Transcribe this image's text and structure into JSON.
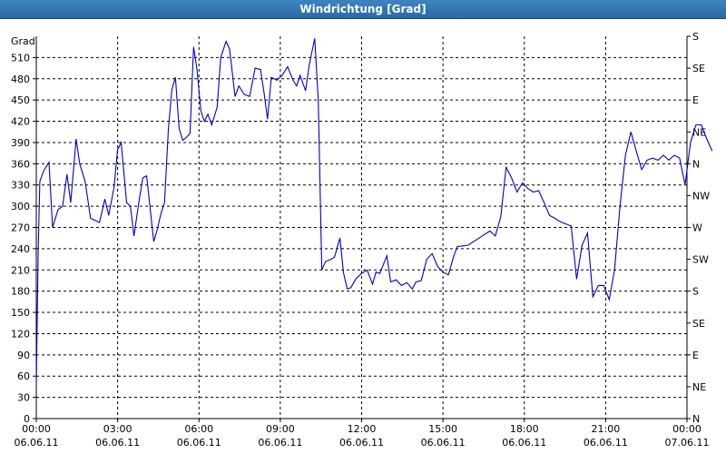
{
  "window": {
    "title": "Windrichtung [Grad]"
  },
  "chart_data": {
    "type": "line",
    "title": "Windrichtung [Grad]",
    "ylabel": "Grad",
    "ylim": [
      0,
      540
    ],
    "y_ticks": [
      0,
      30,
      60,
      90,
      120,
      150,
      180,
      210,
      240,
      270,
      300,
      330,
      360,
      390,
      420,
      450,
      480,
      510
    ],
    "right_axis_labels": [
      "N",
      "NE",
      "E",
      "SE",
      "S",
      "SW",
      "W",
      "NW",
      "N",
      "NE",
      "E",
      "SE",
      "S"
    ],
    "right_axis_values": [
      0,
      45,
      90,
      135,
      180,
      225,
      270,
      315,
      360,
      405,
      450,
      495,
      540
    ],
    "x_range_hours": [
      0,
      24
    ],
    "x_ticks": [
      {
        "h": 0,
        "time": "00:00",
        "date": "06.06.11"
      },
      {
        "h": 3,
        "time": "03:00",
        "date": "06.06.11"
      },
      {
        "h": 6,
        "time": "06:00",
        "date": "06.06.11"
      },
      {
        "h": 9,
        "time": "09:00",
        "date": "06.06.11"
      },
      {
        "h": 12,
        "time": "12:00",
        "date": "06.06.11"
      },
      {
        "h": 15,
        "time": "15:00",
        "date": "06.06.11"
      },
      {
        "h": 18,
        "time": "18:00",
        "date": "06.06.11"
      },
      {
        "h": 21,
        "time": "21:00",
        "date": "06.06.11"
      },
      {
        "h": 24,
        "time": "00:00",
        "date": "07.06.11"
      }
    ],
    "grid": true,
    "line_color": "#0000cc",
    "series": [
      {
        "points": [
          [
            0.0,
            50
          ],
          [
            0.07,
            240
          ],
          [
            0.13,
            335
          ],
          [
            0.27,
            350
          ],
          [
            0.47,
            362
          ],
          [
            0.6,
            270
          ],
          [
            0.8,
            295
          ],
          [
            0.97,
            300
          ],
          [
            1.13,
            345
          ],
          [
            1.27,
            305
          ],
          [
            1.47,
            395
          ],
          [
            1.6,
            360
          ],
          [
            1.8,
            335
          ],
          [
            2.0,
            283
          ],
          [
            2.33,
            277
          ],
          [
            2.53,
            310
          ],
          [
            2.67,
            287
          ],
          [
            2.87,
            327
          ],
          [
            3.0,
            380
          ],
          [
            3.13,
            390
          ],
          [
            3.33,
            305
          ],
          [
            3.47,
            300
          ],
          [
            3.6,
            258
          ],
          [
            3.8,
            310
          ],
          [
            3.93,
            340
          ],
          [
            4.07,
            343
          ],
          [
            4.33,
            250
          ],
          [
            4.47,
            268
          ],
          [
            4.6,
            290
          ],
          [
            4.73,
            305
          ],
          [
            4.87,
            408
          ],
          [
            5.0,
            465
          ],
          [
            5.13,
            482
          ],
          [
            5.27,
            410
          ],
          [
            5.4,
            393
          ],
          [
            5.53,
            397
          ],
          [
            5.67,
            403
          ],
          [
            5.8,
            525
          ],
          [
            5.93,
            492
          ],
          [
            6.07,
            435
          ],
          [
            6.2,
            420
          ],
          [
            6.33,
            430
          ],
          [
            6.47,
            415
          ],
          [
            6.67,
            440
          ],
          [
            6.8,
            510
          ],
          [
            7.0,
            533
          ],
          [
            7.13,
            522
          ],
          [
            7.33,
            455
          ],
          [
            7.47,
            470
          ],
          [
            7.67,
            458
          ],
          [
            7.87,
            455
          ],
          [
            8.07,
            495
          ],
          [
            8.27,
            493
          ],
          [
            8.4,
            460
          ],
          [
            8.53,
            423
          ],
          [
            8.67,
            482
          ],
          [
            8.87,
            478
          ],
          [
            9.07,
            485
          ],
          [
            9.27,
            497
          ],
          [
            9.47,
            478
          ],
          [
            9.6,
            470
          ],
          [
            9.73,
            485
          ],
          [
            9.93,
            463
          ],
          [
            10.07,
            500
          ],
          [
            10.27,
            537
          ],
          [
            10.4,
            450
          ],
          [
            10.53,
            210
          ],
          [
            10.67,
            222
          ],
          [
            10.87,
            225
          ],
          [
            11.0,
            228
          ],
          [
            11.2,
            255
          ],
          [
            11.33,
            206
          ],
          [
            11.47,
            183
          ],
          [
            11.6,
            185
          ],
          [
            11.8,
            198
          ],
          [
            12.0,
            205
          ],
          [
            12.2,
            210
          ],
          [
            12.4,
            190
          ],
          [
            12.53,
            207
          ],
          [
            12.67,
            205
          ],
          [
            12.93,
            230
          ],
          [
            13.07,
            193
          ],
          [
            13.27,
            196
          ],
          [
            13.47,
            188
          ],
          [
            13.67,
            192
          ],
          [
            13.87,
            183
          ],
          [
            14.0,
            193
          ],
          [
            14.2,
            195
          ],
          [
            14.4,
            225
          ],
          [
            14.6,
            233
          ],
          [
            14.8,
            215
          ],
          [
            15.0,
            207
          ],
          [
            15.2,
            203
          ],
          [
            15.4,
            230
          ],
          [
            15.53,
            243
          ],
          [
            15.73,
            244
          ],
          [
            15.93,
            245
          ],
          [
            16.13,
            250
          ],
          [
            16.33,
            255
          ],
          [
            16.53,
            260
          ],
          [
            16.73,
            265
          ],
          [
            16.93,
            258
          ],
          [
            17.13,
            285
          ],
          [
            17.33,
            355
          ],
          [
            17.53,
            340
          ],
          [
            17.73,
            320
          ],
          [
            17.93,
            333
          ],
          [
            18.13,
            325
          ],
          [
            18.33,
            320
          ],
          [
            18.53,
            322
          ],
          [
            18.73,
            305
          ],
          [
            18.93,
            287
          ],
          [
            19.13,
            283
          ],
          [
            19.33,
            278
          ],
          [
            19.53,
            275
          ],
          [
            19.73,
            272
          ],
          [
            19.93,
            197
          ],
          [
            20.13,
            245
          ],
          [
            20.33,
            262
          ],
          [
            20.53,
            172
          ],
          [
            20.73,
            188
          ],
          [
            20.93,
            188
          ],
          [
            21.13,
            168
          ],
          [
            21.33,
            210
          ],
          [
            21.53,
            300
          ],
          [
            21.73,
            372
          ],
          [
            21.93,
            405
          ],
          [
            22.13,
            378
          ],
          [
            22.33,
            352
          ],
          [
            22.53,
            365
          ],
          [
            22.73,
            368
          ],
          [
            22.93,
            365
          ],
          [
            23.13,
            372
          ],
          [
            23.33,
            365
          ],
          [
            23.53,
            372
          ],
          [
            23.73,
            368
          ],
          [
            23.93,
            330
          ],
          [
            24.13,
            390
          ],
          [
            24.33,
            415
          ],
          [
            24.53,
            415
          ],
          [
            24.73,
            395
          ],
          [
            24.93,
            378
          ]
        ]
      }
    ]
  }
}
